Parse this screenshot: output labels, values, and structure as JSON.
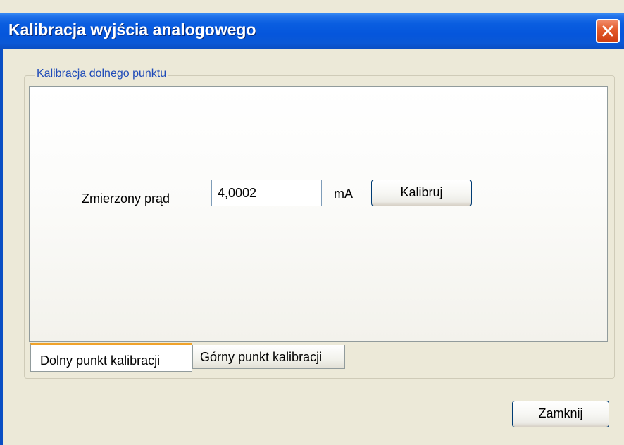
{
  "window": {
    "title": "Kalibracja wyjścia analogowego",
    "close_icon": "close-icon",
    "accent_color": "#0a5ee0",
    "close_color": "#e35a2a"
  },
  "group": {
    "title": "Kalibracja dolnego punktu"
  },
  "form": {
    "measured_current_label": "Zmierzony prąd",
    "measured_current_value": "4,0002",
    "unit": "mA",
    "calibrate_button": "Kalibruj"
  },
  "tabs": [
    {
      "label": "Dolny punkt kalibracji",
      "active": true
    },
    {
      "label": "Górny punkt kalibracji",
      "active": false
    }
  ],
  "footer": {
    "close_button": "Zamknij"
  }
}
